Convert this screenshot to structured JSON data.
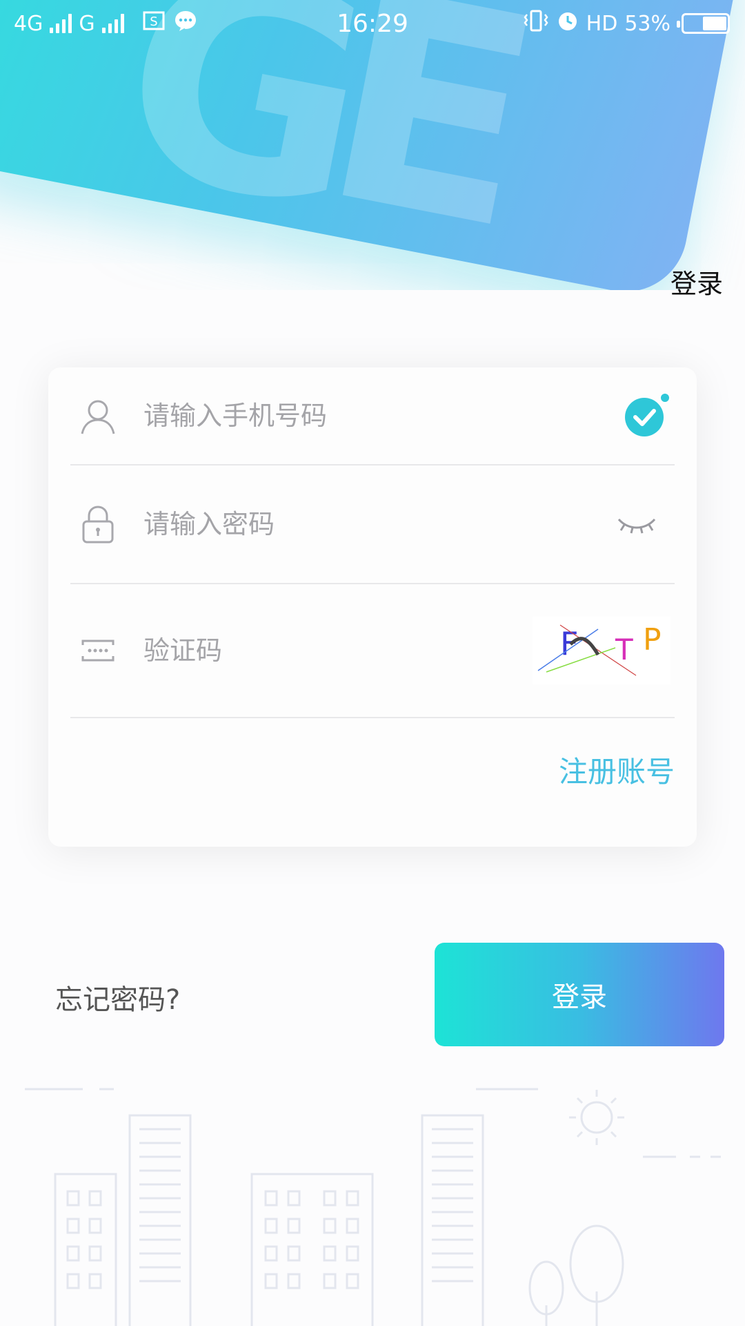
{
  "status_bar": {
    "network_left": "4G",
    "network_right": "G",
    "time": "16:29",
    "hd": "HD",
    "battery_percent": "53%"
  },
  "header": {
    "title": "登录"
  },
  "form": {
    "phone_placeholder": "请输入手机号码",
    "password_placeholder": "请输入密码",
    "captcha_placeholder": "验证码",
    "captcha_chars": [
      "F",
      "T",
      "P"
    ],
    "register_link": "注册账号"
  },
  "actions": {
    "forgot_password": "忘记密码?",
    "login_button": "登录"
  },
  "colors": {
    "accent": "#48c0e2",
    "button_start": "#1de3d6",
    "button_end": "#6e78ee",
    "check": "#2ec7d8"
  },
  "icons": [
    "user-icon",
    "lock-icon",
    "captcha-icon",
    "check-icon",
    "eye-closed-icon",
    "signal-icon",
    "vibrate-icon",
    "alarm-icon",
    "battery-icon"
  ]
}
